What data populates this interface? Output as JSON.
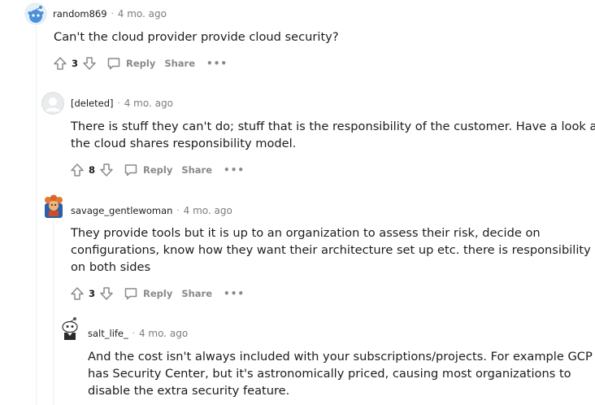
{
  "comments": [
    {
      "author": "random869",
      "time": "4 mo. ago",
      "lines": [
        "Can't the cloud provider provide cloud security?"
      ],
      "score": "3",
      "reply_label": "Reply",
      "share_label": "Share",
      "more_label": "•••"
    },
    {
      "author": "[deleted]",
      "time": "4 mo. ago",
      "lines": [
        "There is stuff they can't do; stuff that is the responsibility of the customer. Have a look at",
        "the cloud shares responsibility model."
      ],
      "score": "8",
      "reply_label": "Reply",
      "share_label": "Share",
      "more_label": "•••"
    },
    {
      "author": "savage_gentlewoman",
      "time": "4 mo. ago",
      "lines": [
        "They provide tools but it is up to an organization to assess their risk, decide on",
        "configurations, know how they want their architecture set up etc. there is responsibility",
        "on both sides"
      ],
      "score": "3",
      "reply_label": "Reply",
      "share_label": "Share",
      "more_label": "•••"
    },
    {
      "author": "salt_life_",
      "time": "4 mo. ago",
      "lines": [
        "And the cost isn't always included with your subscriptions/projects. For example GCP",
        "has Security Center, but it's astronomically priced, causing most organizations to",
        "disable the extra security feature."
      ]
    }
  ],
  "meta_separator": "·",
  "colors": {
    "meta_text": "#7c7c7c",
    "action_text": "#878a8c",
    "thread_line": "#edeff1",
    "snoo_blue": "#4a90d9"
  },
  "icons": [
    "upvote-icon",
    "downvote-icon",
    "reply-icon"
  ]
}
